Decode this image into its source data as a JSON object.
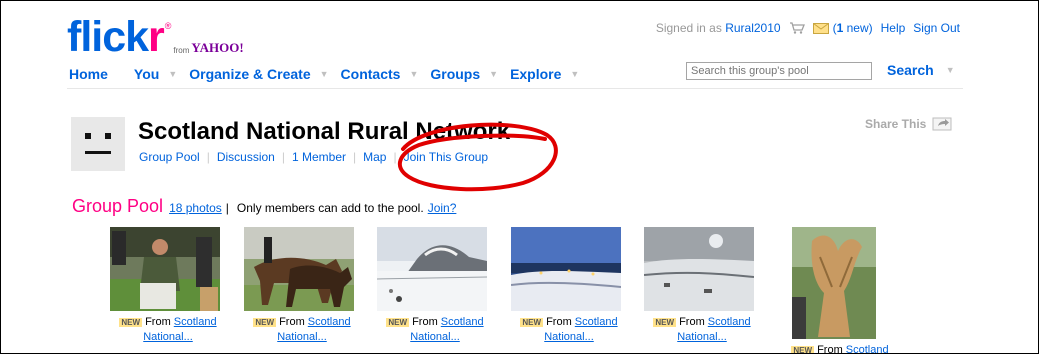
{
  "header": {
    "logo": {
      "main": "flick",
      "accent": "r",
      "registered": "®",
      "from": "from",
      "partner": "YAHOO!"
    },
    "user": {
      "signed_in_prefix": "Signed in as",
      "username": "Rural2010",
      "mail_open": "(",
      "mail_count": "1",
      "mail_rest": " new)",
      "help": "Help",
      "sign_out": "Sign Out"
    },
    "nav": [
      {
        "label": "Home"
      },
      {
        "label": "You"
      },
      {
        "label": "Organize & Create"
      },
      {
        "label": "Contacts"
      },
      {
        "label": "Groups"
      },
      {
        "label": "Explore"
      }
    ],
    "search": {
      "placeholder": "Search this group's pool",
      "button": "Search"
    }
  },
  "group": {
    "title": "Scotland National Rural Network",
    "subnav": {
      "pool": "Group Pool",
      "discussion": "Discussion",
      "members": "1 Member",
      "map": "Map",
      "join": "Join This Group"
    },
    "share": "Share This"
  },
  "pool": {
    "title": "Group Pool",
    "count": "18 photos",
    "separator": "|",
    "note": "Only members can add to the pool.",
    "join": "Join?",
    "photos": [
      {
        "badge": "NEW",
        "from": "From",
        "link1": "Scotland",
        "link2": "National..."
      },
      {
        "badge": "NEW",
        "from": "From",
        "link1": "Scotland",
        "link2": "National..."
      },
      {
        "badge": "NEW",
        "from": "From",
        "link1": "Scotland",
        "link2": "National..."
      },
      {
        "badge": "NEW",
        "from": "From",
        "link1": "Scotland",
        "link2": "National..."
      },
      {
        "badge": "NEW",
        "from": "From",
        "link1": "Scotland",
        "link2": "National..."
      },
      {
        "badge": "NEW",
        "from": "From",
        "link1": "Scotland",
        "link2": ""
      }
    ]
  },
  "colors": {
    "brand_blue": "#0063dc",
    "brand_pink": "#ff0084",
    "annotation_red": "#e00000"
  }
}
